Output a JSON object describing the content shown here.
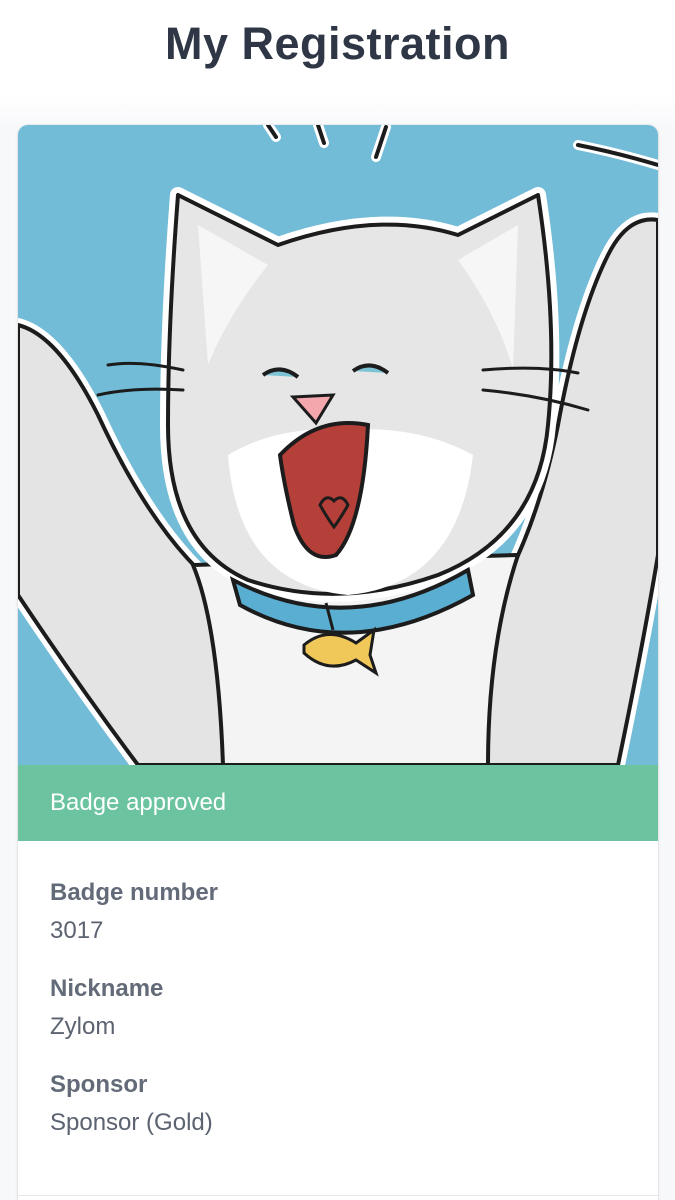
{
  "header": {
    "title": "My Registration"
  },
  "badge": {
    "status_text": "Badge approved",
    "status_color": "#6bc39f",
    "image": "cheering-cat-illustration"
  },
  "details": [
    {
      "label": "Badge number",
      "value": "3017"
    },
    {
      "label": "Nickname",
      "value": "Zylom"
    },
    {
      "label": "Sponsor",
      "value": "Sponsor (Gold)"
    }
  ]
}
